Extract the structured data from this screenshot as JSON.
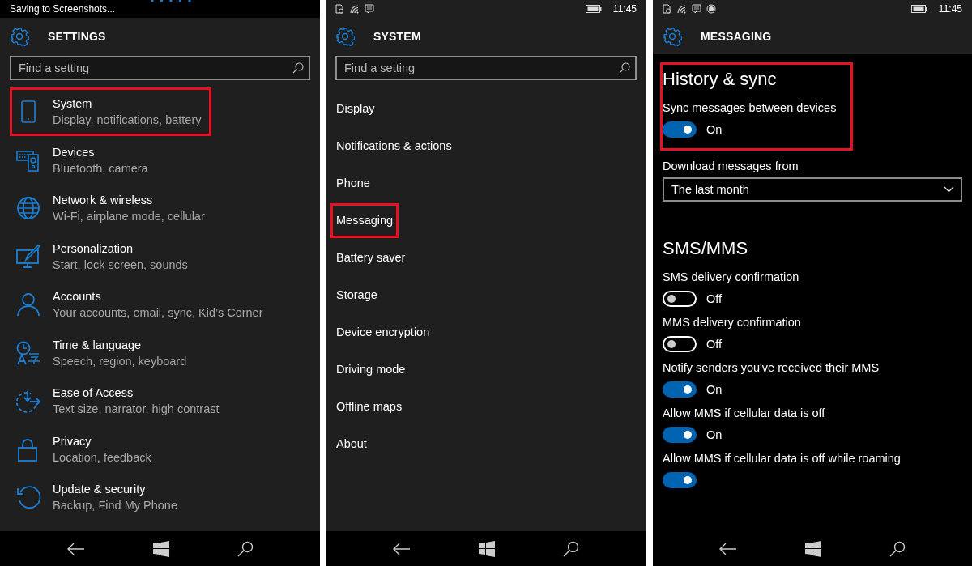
{
  "panels": [
    {
      "kind": "settings_list",
      "status": {
        "kind": "notice",
        "text": "Saving to Screenshots..."
      },
      "title": "SETTINGS",
      "search": {
        "placeholder": "Find a setting"
      },
      "items": [
        {
          "title": "System",
          "subtitle": "Display, notifications, battery",
          "highlighted": true
        },
        {
          "title": "Devices",
          "subtitle": "Bluetooth, camera",
          "highlighted": false
        },
        {
          "title": "Network & wireless",
          "subtitle": "Wi-Fi, airplane mode, cellular",
          "highlighted": false
        },
        {
          "title": "Personalization",
          "subtitle": "Start, lock screen, sounds",
          "highlighted": false
        },
        {
          "title": "Accounts",
          "subtitle": "Your accounts, email, sync, Kid’s Corner",
          "highlighted": false
        },
        {
          "title": "Time & language",
          "subtitle": "Speech, region, keyboard",
          "highlighted": false
        },
        {
          "title": "Ease of Access",
          "subtitle": "Text size, narrator, high contrast",
          "highlighted": false
        },
        {
          "title": "Privacy",
          "subtitle": "Location, feedback",
          "highlighted": false
        },
        {
          "title": "Update & security",
          "subtitle": "Backup, Find My Phone",
          "highlighted": false
        }
      ]
    },
    {
      "kind": "menu",
      "status": {
        "kind": "icons",
        "time": "11:45"
      },
      "title": "SYSTEM",
      "search": {
        "placeholder": "Find a setting"
      },
      "items": [
        {
          "label": "Display",
          "highlighted": false
        },
        {
          "label": "Notifications & actions",
          "highlighted": false
        },
        {
          "label": "Phone",
          "highlighted": false
        },
        {
          "label": "Messaging",
          "highlighted": true
        },
        {
          "label": "Battery saver",
          "highlighted": false
        },
        {
          "label": "Storage",
          "highlighted": false
        },
        {
          "label": "Device encryption",
          "highlighted": false
        },
        {
          "label": "Driving mode",
          "highlighted": false
        },
        {
          "label": "Offline maps",
          "highlighted": false
        },
        {
          "label": "About",
          "highlighted": false
        }
      ]
    },
    {
      "kind": "page",
      "status": {
        "kind": "icons",
        "time": "11:45"
      },
      "title": "MESSAGING",
      "blocks": [
        {
          "kind": "group",
          "highlighted": true,
          "blocks": [
            {
              "kind": "heading",
              "text": "History & sync"
            },
            {
              "kind": "toggle",
              "label": "Sync messages between devices",
              "on": true,
              "state": "On"
            }
          ]
        },
        {
          "kind": "dropdown",
          "label": "Download messages from",
          "value": "The last month"
        },
        {
          "kind": "heading",
          "text": "SMS/MMS"
        },
        {
          "kind": "toggle",
          "label": "SMS delivery confirmation",
          "on": false,
          "state": "Off"
        },
        {
          "kind": "toggle",
          "label": "MMS delivery confirmation",
          "on": false,
          "state": "Off"
        },
        {
          "kind": "toggle",
          "label": "Notify senders you've received their MMS",
          "on": true,
          "state": "On"
        },
        {
          "kind": "toggle",
          "label": "Allow MMS if cellular data is off",
          "on": true,
          "state": "On"
        },
        {
          "kind": "toggle",
          "label": "Allow MMS if cellular data is off while roaming",
          "on": true
        }
      ]
    }
  ]
}
